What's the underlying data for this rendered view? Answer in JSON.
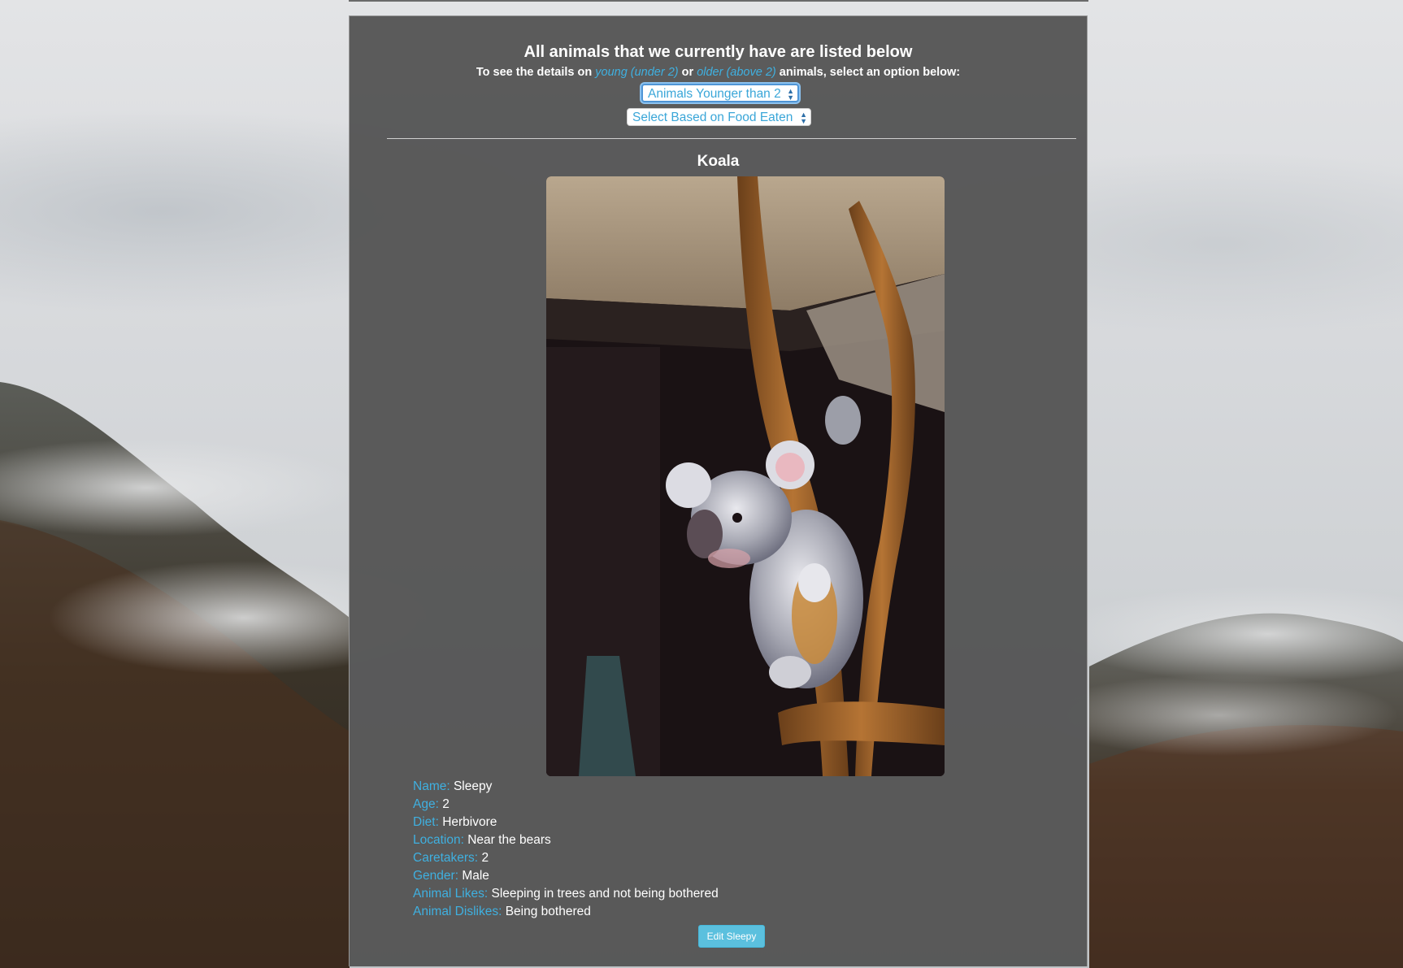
{
  "header": {
    "title": "All animals that we currently have are listed below",
    "subtitle_prefix": "To see the details on",
    "young_link": "young (under 2)",
    "or_text": "or",
    "older_link": "older (above 2)",
    "subtitle_suffix": "animals, select an option below:"
  },
  "filters": {
    "age_select_value": "Animals Younger than 2",
    "food_select_value": "Select Based on Food Eaten"
  },
  "animal": {
    "species": "Koala",
    "details": [
      {
        "label": "Name:",
        "value": "Sleepy"
      },
      {
        "label": "Age:",
        "value": "2"
      },
      {
        "label": "Diet:",
        "value": "Herbivore"
      },
      {
        "label": "Location:",
        "value": "Near the bears"
      },
      {
        "label": "Caretakers:",
        "value": "2"
      },
      {
        "label": "Gender:",
        "value": "Male"
      },
      {
        "label": "Animal Likes:",
        "value": "Sleeping in trees and not being bothered"
      },
      {
        "label": "Animal Dislikes:",
        "value": "Being bothered"
      }
    ],
    "edit_button": "Edit Sleepy"
  },
  "colors": {
    "accent": "#3fb0e0",
    "button": "#5bc0de",
    "panel": "#525252"
  }
}
